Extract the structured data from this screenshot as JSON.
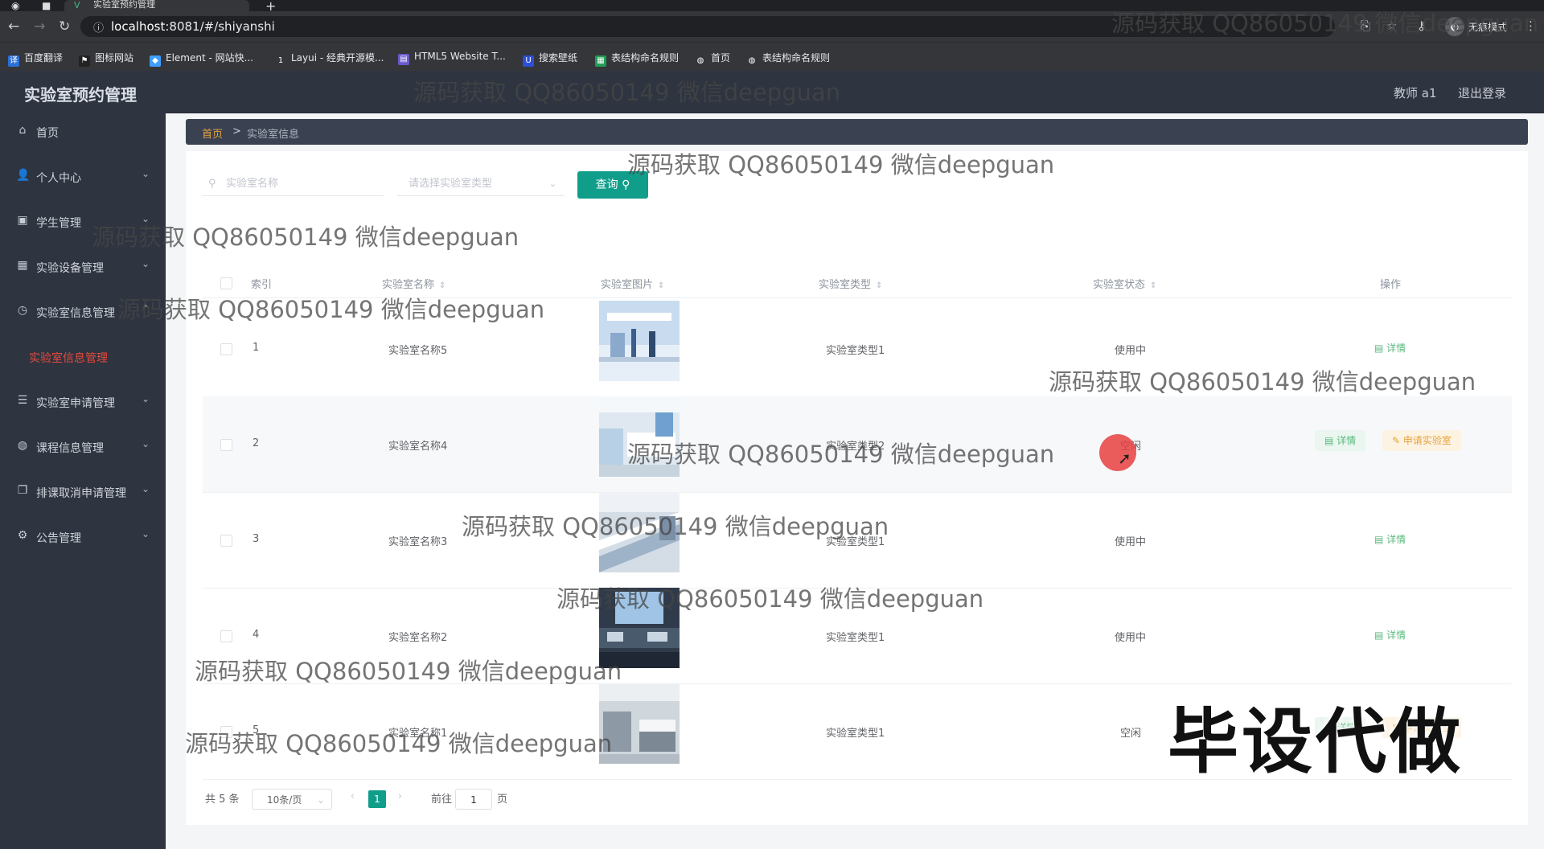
{
  "browser": {
    "tab_title": "实验室预约管理",
    "url_host": "localhost",
    "url_rest": ":8081/#/shiyanshi",
    "profile_label": "无痕模式",
    "bookmarks": [
      "百度翻译",
      "图标网站",
      "Element - 网站快...",
      "Layui - 经典开源模...",
      "HTML5 Website T...",
      "搜索壁纸",
      "表结构命名规则",
      "首页",
      "表结构命名规则"
    ]
  },
  "header": {
    "title": "实验室预约管理",
    "user": "教师 a1",
    "logout": "退出登录"
  },
  "sidebar": {
    "items": [
      {
        "label": "首页",
        "icon": "home-icon"
      },
      {
        "label": "个人中心",
        "icon": "user-icon"
      },
      {
        "label": "学生管理",
        "icon": "clipboard-icon"
      },
      {
        "label": "实验设备管理",
        "icon": "grid-icon"
      },
      {
        "label": "实验室信息管理",
        "icon": "clock-icon"
      },
      {
        "label": "实验室申请管理",
        "icon": "sliders-icon"
      },
      {
        "label": "课程信息管理",
        "icon": "globe-icon"
      },
      {
        "label": "排课取消申请管理",
        "icon": "copy-icon"
      },
      {
        "label": "公告管理",
        "icon": "settings-icon"
      }
    ],
    "active_sub": "实验室信息管理"
  },
  "breadcrumb": {
    "home": "首页",
    "separator": ">",
    "current": "实验室信息"
  },
  "search": {
    "name_placeholder": "实验室名称",
    "type_placeholder": "请选择实验室类型",
    "query_label": "查询"
  },
  "table": {
    "columns": [
      "索引",
      "实验室名称",
      "实验室图片",
      "实验室类型",
      "实验室状态",
      "操作"
    ],
    "rows": [
      {
        "index": "1",
        "name": "实验室名称5",
        "type": "实验室类型1",
        "status": "使用中",
        "actions": [
          "详情"
        ]
      },
      {
        "index": "2",
        "name": "实验室名称4",
        "type": "实验室类型2",
        "status": "空闲",
        "actions": [
          "详情",
          "申请实验室"
        ]
      },
      {
        "index": "3",
        "name": "实验室名称3",
        "type": "实验室类型1",
        "status": "使用中",
        "actions": [
          "详情"
        ]
      },
      {
        "index": "4",
        "name": "实验室名称2",
        "type": "实验室类型1",
        "status": "使用中",
        "actions": [
          "详情"
        ]
      },
      {
        "index": "5",
        "name": "实验室名称1",
        "type": "实验室类型1",
        "status": "空闲",
        "actions": [
          "详情",
          "申请实验室"
        ]
      }
    ]
  },
  "pagination": {
    "total": "共 5 条",
    "page_size": "10条/页",
    "current_page": "1",
    "goto_label": "前往",
    "goto_value": "1",
    "page_suffix": "页"
  },
  "watermark": "源码获取 QQ86050149 微信deepguan",
  "promo": "毕设代做",
  "colors": {
    "accent": "#109e8b",
    "sidebar": "#2e3440",
    "active": "#e64a3c"
  }
}
